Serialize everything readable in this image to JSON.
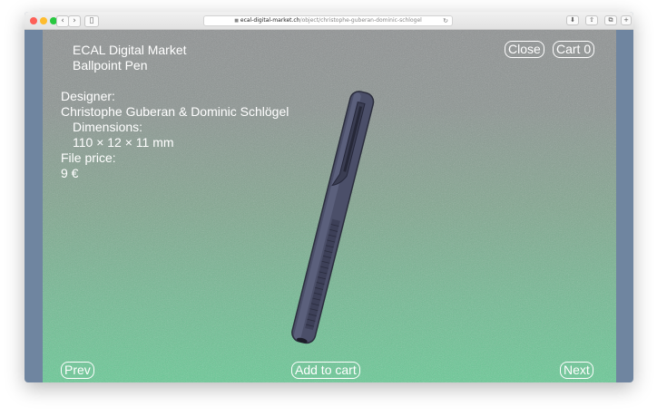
{
  "browser": {
    "url_domain": "ecal-digital-market.ch",
    "url_path": "/object/christophe-guberan-dominic-schlogel",
    "back_glyph": "‹",
    "forward_glyph": "›",
    "sidebar_glyph": "▯",
    "reload_glyph": "↻",
    "download_glyph": "⬇",
    "share_glyph": "⇧",
    "tabs_glyph": "⧉",
    "newtab_glyph": "+"
  },
  "site": {
    "title": "ECAL Digital Market",
    "product_name": "Ballpoint Pen",
    "designer_label": "Designer:",
    "designer_value": "Christophe Guberan & Dominic Schlögel",
    "dimensions_label": "Dimensions:",
    "dimensions_value": "110 × 12 × 11 mm",
    "price_label": "File price:",
    "price_value": "9 €",
    "close_label": "Close",
    "cart_label": "Cart 0",
    "prev_label": "Prev",
    "add_to_cart_label": "Add to cart",
    "next_label": "Next"
  },
  "colors": {
    "pen_body": "#4b4f69",
    "pen_dark": "#2b2d3d",
    "text": "#ffffff"
  }
}
